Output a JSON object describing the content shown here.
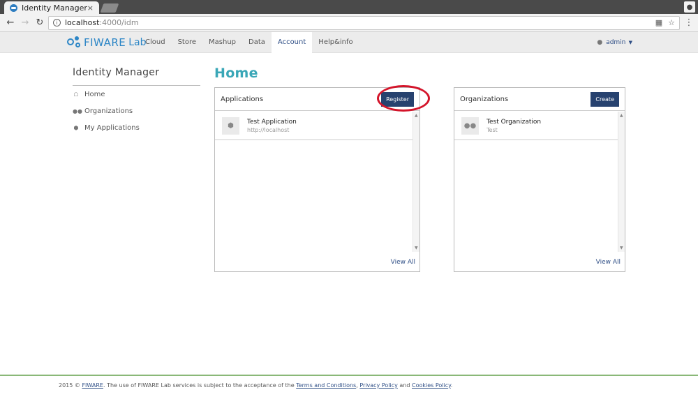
{
  "browser": {
    "tab_title": "Identity Manager",
    "tab_close": "×",
    "url_host": "localhost",
    "url_path": ":4000/idm"
  },
  "header": {
    "brand": "FIWARE",
    "brand_lab": "Lab",
    "nav": [
      {
        "label": "Cloud"
      },
      {
        "label": "Store"
      },
      {
        "label": "Mashup"
      },
      {
        "label": "Data"
      },
      {
        "label": "Account",
        "active": true
      },
      {
        "label": "Help&info"
      }
    ],
    "user": "admin"
  },
  "sidebar": {
    "title": "Identity Manager",
    "items": [
      {
        "label": "Home",
        "icon": "home-icon"
      },
      {
        "label": "Organizations",
        "icon": "users-icon"
      },
      {
        "label": "My Applications",
        "icon": "cube-icon"
      }
    ]
  },
  "main": {
    "title": "Home",
    "applications": {
      "title": "Applications",
      "button": "Register",
      "items": [
        {
          "name": "Test Application",
          "sub": "http://localhost",
          "icon": "cube-icon"
        }
      ],
      "view_all": "View All"
    },
    "organizations": {
      "title": "Organizations",
      "button": "Create",
      "items": [
        {
          "name": "Test Organization",
          "sub": "Test",
          "icon": "users-icon"
        }
      ],
      "view_all": "View All"
    }
  },
  "footer": {
    "prefix": "2015 © ",
    "fiware_link": "FIWARE",
    "text1": ". The use of FIWARE Lab services is subject to the acceptance of the ",
    "terms": "Terms and Conditions",
    "sep1": ", ",
    "privacy": "Privacy Policy",
    "sep2": " and ",
    "cookies": "Cookies Policy",
    "end": "."
  },
  "colors": {
    "accent": "#3aa7b7",
    "primary": "#27426f",
    "brand": "#2c86c6",
    "highlight": "#d4142a"
  }
}
